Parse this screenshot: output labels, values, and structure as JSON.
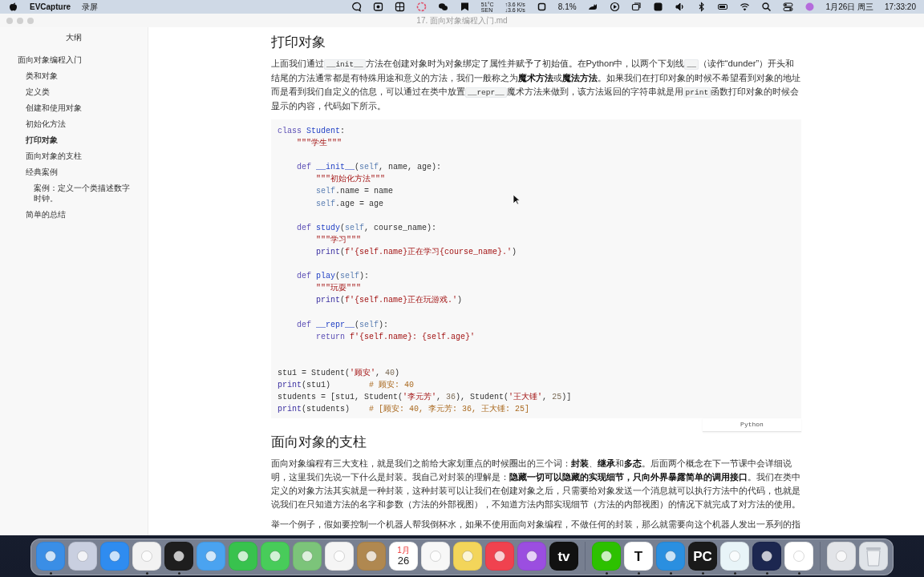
{
  "menu_bar": {
    "app_name": "EVCapture",
    "menus": [
      "录屏"
    ],
    "temperature": "51°C",
    "sensor": "SEN",
    "upload": "↑3.6 K/s",
    "download": "↓3.6 K/s",
    "cpu": "8.1%",
    "date": "1月26日 周三",
    "time": "17:33:20"
  },
  "window": {
    "title": "17. 面向对象编程入门.md"
  },
  "sidebar": {
    "title": "大纲",
    "items": [
      {
        "label": "面向对象编程入门",
        "selected": false,
        "children": [
          {
            "label": "类和对象",
            "selected": false
          },
          {
            "label": "定义类",
            "selected": false
          },
          {
            "label": "创建和使用对象",
            "selected": false
          },
          {
            "label": "初始化方法",
            "selected": false
          },
          {
            "label": "打印对象",
            "selected": true
          },
          {
            "label": "面向对象的支柱",
            "selected": false
          },
          {
            "label": "经典案例",
            "selected": false,
            "children": [
              {
                "label": "案例：定义一个类描述数字时钟。",
                "selected": false
              }
            ]
          },
          {
            "label": "简单的总结",
            "selected": false
          }
        ]
      }
    ]
  },
  "document": [
    {
      "kind": "heading",
      "text": "打印对象"
    },
    {
      "kind": "paragraph",
      "segments": [
        {
          "text": "上面我们通过",
          "kind": "text"
        },
        {
          "text": "__init__",
          "kind": "code"
        },
        {
          "text": "方法在创建对象时为对象绑定了属性并赋予了初始值。在Python中，以两个下划线",
          "kind": "text"
        },
        {
          "text": "__",
          "kind": "code"
        },
        {
          "text": "（读作“dunder”）开头和结尾的方法通常都是有特殊用途和意义的方法，我们一般称之为",
          "kind": "text"
        },
        {
          "text": "魔术方法",
          "kind": "bold"
        },
        {
          "text": "或",
          "kind": "text"
        },
        {
          "text": "魔法方法",
          "kind": "bold"
        },
        {
          "text": "。如果我们在打印对象的时候不希望看到对象的地址而是看到我们自定义的信息，可以通过在类中放置",
          "kind": "text"
        },
        {
          "text": "__repr__",
          "kind": "code"
        },
        {
          "text": "魔术方法来做到，该方法返回的字符串就是用",
          "kind": "text"
        },
        {
          "text": "print",
          "kind": "code"
        },
        {
          "text": "函数打印对象的时候会显示的内容，代码如下所示。",
          "kind": "text"
        }
      ]
    },
    {
      "kind": "code",
      "language": "Python",
      "lines": [
        {
          "kind": "top",
          "tokens": [
            {
              "text": "class ",
              "kind": "keyword"
            },
            {
              "text": "Student",
              "kind": "def"
            },
            {
              "text": ":",
              "kind": "plain"
            }
          ]
        },
        {
          "kind": "indent1",
          "tokens": [
            {
              "text": "\"\"\"学生\"\"\"",
              "kind": "string"
            }
          ]
        },
        {
          "kind": "blank"
        },
        {
          "kind": "indent1",
          "tokens": [
            {
              "text": "def ",
              "kind": "keyword"
            },
            {
              "text": "__init__",
              "kind": "def"
            },
            {
              "text": "(",
              "kind": "plain"
            },
            {
              "text": "self",
              "kind": "self"
            },
            {
              "text": ", name, age):",
              "kind": "plain"
            }
          ]
        },
        {
          "kind": "indent2",
          "tokens": [
            {
              "text": "\"\"\"初始化方法\"\"\"",
              "kind": "string"
            }
          ]
        },
        {
          "kind": "indent2",
          "tokens": [
            {
              "text": "self",
              "kind": "self"
            },
            {
              "text": ".name = name",
              "kind": "plain"
            }
          ]
        },
        {
          "kind": "indent2",
          "tokens": [
            {
              "text": "self",
              "kind": "self"
            },
            {
              "text": ".age = age",
              "kind": "plain"
            }
          ]
        },
        {
          "kind": "blank"
        },
        {
          "kind": "indent1",
          "tokens": [
            {
              "text": "def ",
              "kind": "keyword"
            },
            {
              "text": "study",
              "kind": "def"
            },
            {
              "text": "(",
              "kind": "plain"
            },
            {
              "text": "self",
              "kind": "self"
            },
            {
              "text": ", course_name):",
              "kind": "plain"
            }
          ]
        },
        {
          "kind": "indent2",
          "tokens": [
            {
              "text": "\"\"\"学习\"\"\"",
              "kind": "string"
            }
          ]
        },
        {
          "kind": "indent2",
          "tokens": [
            {
              "text": "print",
              "kind": "builtin"
            },
            {
              "text": "(",
              "kind": "plain"
            },
            {
              "text": "f'{self.name}正在学习{course_name}.'",
              "kind": "string"
            },
            {
              "text": ")",
              "kind": "plain"
            }
          ]
        },
        {
          "kind": "blank"
        },
        {
          "kind": "indent1",
          "tokens": [
            {
              "text": "def ",
              "kind": "keyword"
            },
            {
              "text": "play",
              "kind": "def"
            },
            {
              "text": "(",
              "kind": "plain"
            },
            {
              "text": "self",
              "kind": "self"
            },
            {
              "text": "):",
              "kind": "plain"
            }
          ]
        },
        {
          "kind": "indent2",
          "tokens": [
            {
              "text": "\"\"\"玩耍\"\"\"",
              "kind": "string"
            }
          ]
        },
        {
          "kind": "indent2",
          "tokens": [
            {
              "text": "print",
              "kind": "builtin"
            },
            {
              "text": "(",
              "kind": "plain"
            },
            {
              "text": "f'{self.name}正在玩游戏.'",
              "kind": "string"
            },
            {
              "text": ")",
              "kind": "plain"
            }
          ]
        },
        {
          "kind": "blank"
        },
        {
          "kind": "indent1",
          "tokens": [
            {
              "text": "def ",
              "kind": "keyword"
            },
            {
              "text": "__repr__",
              "kind": "def"
            },
            {
              "text": "(",
              "kind": "plain"
            },
            {
              "text": "self",
              "kind": "self"
            },
            {
              "text": "):",
              "kind": "plain"
            }
          ]
        },
        {
          "kind": "indent2",
          "tokens": [
            {
              "text": "return ",
              "kind": "keyword"
            },
            {
              "text": "f'{self.name}: {self.age}'",
              "kind": "string"
            }
          ]
        },
        {
          "kind": "blank"
        },
        {
          "kind": "blank"
        },
        {
          "kind": "top",
          "tokens": [
            {
              "text": "stu1 = Student(",
              "kind": "plain"
            },
            {
              "text": "'顾安'",
              "kind": "string"
            },
            {
              "text": ", ",
              "kind": "plain"
            },
            {
              "text": "40",
              "kind": "number"
            },
            {
              "text": ")",
              "kind": "plain"
            }
          ]
        },
        {
          "kind": "top",
          "tokens": [
            {
              "text": "print",
              "kind": "builtin"
            },
            {
              "text": "(stu1)        ",
              "kind": "plain"
            },
            {
              "text": "# 顾安: 40",
              "kind": "comment"
            }
          ]
        },
        {
          "kind": "top",
          "tokens": [
            {
              "text": "students = [stu1, Student(",
              "kind": "plain"
            },
            {
              "text": "'李元芳'",
              "kind": "string"
            },
            {
              "text": ", ",
              "kind": "plain"
            },
            {
              "text": "36",
              "kind": "number"
            },
            {
              "text": "), Student(",
              "kind": "plain"
            },
            {
              "text": "'王大锤'",
              "kind": "string"
            },
            {
              "text": ", ",
              "kind": "plain"
            },
            {
              "text": "25",
              "kind": "number"
            },
            {
              "text": ")]",
              "kind": "plain"
            }
          ]
        },
        {
          "kind": "top",
          "tokens": [
            {
              "text": "print",
              "kind": "builtin"
            },
            {
              "text": "(students)    ",
              "kind": "plain"
            },
            {
              "text": "# [顾安: 40, 李元芳: 36, 王大锤: 25]",
              "kind": "comment"
            }
          ]
        }
      ]
    },
    {
      "kind": "heading",
      "text": "面向对象的支柱"
    },
    {
      "kind": "paragraph",
      "segments": [
        {
          "text": "面向对象编程有三大支柱，就是我们之前给大家划重点的时候圈出的三个词：",
          "kind": "text"
        },
        {
          "text": "封装",
          "kind": "bold"
        },
        {
          "text": "、",
          "kind": "text"
        },
        {
          "text": "继承",
          "kind": "bold"
        },
        {
          "text": "和",
          "kind": "text"
        },
        {
          "text": "多态",
          "kind": "bold"
        },
        {
          "text": "。后面两个概念在下一节课中会详细说明，这里我们先说一下什么是封装。我自己对封装的理解是：",
          "kind": "text"
        },
        {
          "text": "隐藏一切可以隐藏的实现细节，只向外界暴露简单的调用接口",
          "kind": "bold"
        },
        {
          "text": "。我们在类中定义的对象方法其实就是一种封装，这种封装可以让我们在创建对象之后，只需要给对象发送一个消息就可以执行方法中的代码，也就是说我们在只知道方法的名字和参数（方法的外部视图），不知道方法内部实现细节（方法的内部视图）的情况下就完成了对方法的使用。",
          "kind": "text"
        }
      ]
    },
    {
      "kind": "paragraph",
      "segments": [
        {
          "text": "举一个例子，假如要控制一个机器人帮我倒杯水，如果不使用面向对象编程，不做任何的封装，那么就需要向这个机器人发出一系列的指",
          "kind": "text"
        }
      ]
    }
  ],
  "dock": {
    "sections": [
      {
        "apps": [
          {
            "kind": "app",
            "color": "#3a8ee6",
            "running": true
          },
          {
            "kind": "app",
            "color": "#c9cfe0",
            "running": false
          },
          {
            "kind": "app",
            "color": "#2f8cf0",
            "running": false
          },
          {
            "kind": "app",
            "color": "#f2f2f2",
            "running": true
          },
          {
            "kind": "app",
            "color": "#1e1e1e",
            "running": true
          },
          {
            "kind": "app",
            "color": "#4aa3f0",
            "running": false
          },
          {
            "kind": "app",
            "color": "#38c24e",
            "running": false
          },
          {
            "kind": "app",
            "color": "#48cc5a",
            "running": false
          },
          {
            "kind": "app",
            "color": "#7cc47a",
            "running": false
          },
          {
            "kind": "app",
            "color": "#f5f5f5",
            "running": false
          },
          {
            "kind": "app",
            "color": "#b08850",
            "running": false
          },
          {
            "kind": "calendar",
            "color": "#ffffff",
            "month": "1月",
            "day": "26",
            "running": false
          },
          {
            "kind": "app",
            "color": "#f7f7f7",
            "running": false
          },
          {
            "kind": "app",
            "color": "#f3d55a",
            "running": false
          },
          {
            "kind": "app",
            "color": "#f0424f",
            "running": false
          },
          {
            "kind": "app",
            "color": "#9b4ee0",
            "running": false
          },
          {
            "kind": "glyph",
            "color": "#111111",
            "glyph": "tv",
            "running": false
          }
        ]
      },
      {
        "apps": [
          {
            "kind": "app",
            "color": "#2dc100",
            "running": true
          },
          {
            "kind": "glyph",
            "color": "#ffffff",
            "glyph": "T",
            "running": true
          },
          {
            "kind": "app",
            "color": "#2a8fe0",
            "running": true
          },
          {
            "kind": "glyph",
            "color": "#1a1a1a",
            "glyph": "PC",
            "running": true
          },
          {
            "kind": "app",
            "color": "#e8f4f8",
            "running": true
          },
          {
            "kind": "app",
            "color": "#1c2750",
            "running": true
          },
          {
            "kind": "app",
            "color": "#ffffff",
            "running": true
          }
        ]
      },
      {
        "apps": [
          {
            "kind": "app",
            "color": "#e2e4e8",
            "running": false
          },
          {
            "kind": "trash",
            "color": "#dfe3e8",
            "running": false
          }
        ]
      }
    ]
  }
}
